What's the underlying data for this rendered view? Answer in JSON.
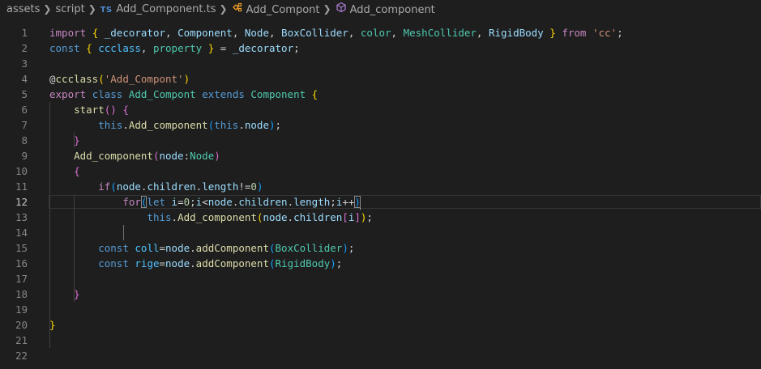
{
  "breadcrumb": {
    "items": [
      {
        "label": "assets",
        "icon": null
      },
      {
        "label": "script",
        "icon": null
      },
      {
        "label": "Add_Component.ts",
        "icon": "ts-file-icon",
        "icon_text": "TS"
      },
      {
        "label": "Add_Compont",
        "icon": "class-symbol-icon"
      },
      {
        "label": "Add_component",
        "icon": "method-symbol-icon"
      }
    ],
    "separator": ">"
  },
  "editor": {
    "active_line": 12,
    "colors": {
      "background": "#1e1e1e",
      "keyword": "#569cd6",
      "control": "#c586c0",
      "variable": "#9cdcfe",
      "type": "#4ec9b0",
      "function": "#dcdcaa",
      "string": "#ce9178",
      "number": "#b5cea8",
      "bracket1": "#ffd700",
      "bracket2": "#da70d6",
      "bracket3": "#179fff",
      "text": "#d4d4d4",
      "line_number": "#858585"
    },
    "lines": [
      {
        "n": "1",
        "tokens": [
          [
            "import",
            "#c586c0"
          ],
          [
            " ",
            ""
          ],
          [
            "{",
            "#ffd700"
          ],
          [
            " ",
            ""
          ],
          [
            "_decorator",
            "#9cdcfe"
          ],
          [
            ", ",
            ""
          ],
          [
            "Component",
            "#9cdcfe"
          ],
          [
            ", ",
            ""
          ],
          [
            "Node",
            "#9cdcfe"
          ],
          [
            ", ",
            ""
          ],
          [
            "BoxCollider",
            "#9cdcfe"
          ],
          [
            ", ",
            ""
          ],
          [
            "color",
            "#4ec9b0"
          ],
          [
            ", ",
            ""
          ],
          [
            "MeshCollider",
            "#4ec9b0"
          ],
          [
            ", ",
            ""
          ],
          [
            "RigidBody",
            "#9cdcfe"
          ],
          [
            " ",
            ""
          ],
          [
            "}",
            "#ffd700"
          ],
          [
            " ",
            ""
          ],
          [
            "from",
            "#c586c0"
          ],
          [
            " ",
            ""
          ],
          [
            "'cc'",
            "#ce9178"
          ],
          [
            ";",
            ""
          ]
        ]
      },
      {
        "n": "2",
        "tokens": [
          [
            "const",
            "#569cd6"
          ],
          [
            " ",
            ""
          ],
          [
            "{",
            "#ffd700"
          ],
          [
            " ",
            ""
          ],
          [
            "ccclass",
            "#4fc1ff"
          ],
          [
            ", ",
            ""
          ],
          [
            "property",
            "#4ec9b0"
          ],
          [
            " ",
            ""
          ],
          [
            "}",
            "#ffd700"
          ],
          [
            " = ",
            ""
          ],
          [
            "_decorator",
            "#9cdcfe"
          ],
          [
            ";",
            ""
          ]
        ]
      },
      {
        "n": "3",
        "tokens": []
      },
      {
        "n": "4",
        "tokens": [
          [
            "@",
            "#d4d4d4"
          ],
          [
            "ccclass",
            "#dcdcaa"
          ],
          [
            "(",
            "#ffd700"
          ],
          [
            "'Add_Compont'",
            "#ce9178"
          ],
          [
            ")",
            "#ffd700"
          ]
        ]
      },
      {
        "n": "5",
        "tokens": [
          [
            "export",
            "#c586c0"
          ],
          [
            " ",
            ""
          ],
          [
            "class",
            "#569cd6"
          ],
          [
            " ",
            ""
          ],
          [
            "Add_Compont",
            "#4ec9b0"
          ],
          [
            " ",
            ""
          ],
          [
            "extends",
            "#569cd6"
          ],
          [
            " ",
            ""
          ],
          [
            "Component",
            "#4ec9b0"
          ],
          [
            " ",
            ""
          ],
          [
            "{",
            "#ffd700"
          ]
        ]
      },
      {
        "n": "6",
        "tokens": [
          [
            "    ",
            ""
          ],
          [
            "start",
            "#dcdcaa"
          ],
          [
            "()",
            "#da70d6"
          ],
          [
            " ",
            ""
          ],
          [
            "{",
            "#da70d6"
          ]
        ]
      },
      {
        "n": "7",
        "tokens": [
          [
            "        ",
            ""
          ],
          [
            "this",
            "#569cd6"
          ],
          [
            ".",
            ""
          ],
          [
            "Add_component",
            "#dcdcaa"
          ],
          [
            "(",
            "#179fff"
          ],
          [
            "this",
            "#569cd6"
          ],
          [
            ".",
            ""
          ],
          [
            "node",
            "#9cdcfe"
          ],
          [
            ")",
            "#179fff"
          ],
          [
            ";",
            ""
          ]
        ]
      },
      {
        "n": "8",
        "tokens": [
          [
            "    ",
            ""
          ],
          [
            "}",
            "#da70d6"
          ]
        ]
      },
      {
        "n": "9",
        "tokens": [
          [
            "    ",
            ""
          ],
          [
            "Add_component",
            "#dcdcaa"
          ],
          [
            "(",
            "#da70d6"
          ],
          [
            "node",
            "#9cdcfe"
          ],
          [
            ":",
            ""
          ],
          [
            "Node",
            "#4ec9b0"
          ],
          [
            ")",
            "#da70d6"
          ]
        ]
      },
      {
        "n": "10",
        "tokens": [
          [
            "    ",
            ""
          ],
          [
            "{",
            "#da70d6"
          ]
        ]
      },
      {
        "n": "11",
        "tokens": [
          [
            "        ",
            ""
          ],
          [
            "if",
            "#c586c0"
          ],
          [
            "(",
            "#179fff"
          ],
          [
            "node",
            "#9cdcfe"
          ],
          [
            ".",
            ""
          ],
          [
            "children",
            "#9cdcfe"
          ],
          [
            ".",
            ""
          ],
          [
            "length",
            "#9cdcfe"
          ],
          [
            "!=",
            ""
          ],
          [
            "0",
            "#b5cea8"
          ],
          [
            ")",
            "#179fff"
          ]
        ]
      },
      {
        "n": "12",
        "tokens": [
          [
            "            ",
            ""
          ],
          [
            "for",
            "#c586c0"
          ],
          [
            "(",
            "#179fff"
          ],
          [
            "let",
            "#569cd6"
          ],
          [
            " ",
            ""
          ],
          [
            "i",
            "#9cdcfe"
          ],
          [
            "=",
            ""
          ],
          [
            "0",
            "#b5cea8"
          ],
          [
            ";",
            ""
          ],
          [
            "i",
            "#9cdcfe"
          ],
          [
            "<",
            ""
          ],
          [
            "node",
            "#9cdcfe"
          ],
          [
            ".",
            ""
          ],
          [
            "children",
            "#9cdcfe"
          ],
          [
            ".",
            ""
          ],
          [
            "length",
            "#9cdcfe"
          ],
          [
            ";",
            ""
          ],
          [
            "i",
            "#9cdcfe"
          ],
          [
            "++",
            ""
          ],
          [
            ")",
            "#179fff"
          ]
        ]
      },
      {
        "n": "13",
        "tokens": [
          [
            "                ",
            ""
          ],
          [
            "this",
            "#569cd6"
          ],
          [
            ".",
            ""
          ],
          [
            "Add_component",
            "#dcdcaa"
          ],
          [
            "(",
            "#ffd700"
          ],
          [
            "node",
            "#9cdcfe"
          ],
          [
            ".",
            ""
          ],
          [
            "children",
            "#9cdcfe"
          ],
          [
            "[",
            "#da70d6"
          ],
          [
            "i",
            "#9cdcfe"
          ],
          [
            "]",
            "#da70d6"
          ],
          [
            ")",
            "#ffd700"
          ],
          [
            ";",
            ""
          ]
        ]
      },
      {
        "n": "14",
        "tokens": []
      },
      {
        "n": "15",
        "tokens": [
          [
            "        ",
            ""
          ],
          [
            "const",
            "#569cd6"
          ],
          [
            " ",
            ""
          ],
          [
            "coll",
            "#4fc1ff"
          ],
          [
            "=",
            ""
          ],
          [
            "node",
            "#9cdcfe"
          ],
          [
            ".",
            ""
          ],
          [
            "addComponent",
            "#dcdcaa"
          ],
          [
            "(",
            "#179fff"
          ],
          [
            "BoxCollider",
            "#4ec9b0"
          ],
          [
            ")",
            "#179fff"
          ],
          [
            ";",
            ""
          ]
        ]
      },
      {
        "n": "16",
        "tokens": [
          [
            "        ",
            ""
          ],
          [
            "const",
            "#569cd6"
          ],
          [
            " ",
            ""
          ],
          [
            "rige",
            "#4fc1ff"
          ],
          [
            "=",
            ""
          ],
          [
            "node",
            "#9cdcfe"
          ],
          [
            ".",
            ""
          ],
          [
            "addComponent",
            "#dcdcaa"
          ],
          [
            "(",
            "#179fff"
          ],
          [
            "RigidBody",
            "#4ec9b0"
          ],
          [
            ")",
            "#179fff"
          ],
          [
            ";",
            ""
          ]
        ]
      },
      {
        "n": "17",
        "tokens": []
      },
      {
        "n": "18",
        "tokens": [
          [
            "    ",
            ""
          ],
          [
            "}",
            "#da70d6"
          ]
        ]
      },
      {
        "n": "19",
        "tokens": []
      },
      {
        "n": "20",
        "tokens": [
          [
            "}",
            "#ffd700"
          ]
        ]
      },
      {
        "n": "21",
        "tokens": []
      },
      {
        "n": "22",
        "tokens": []
      }
    ]
  }
}
